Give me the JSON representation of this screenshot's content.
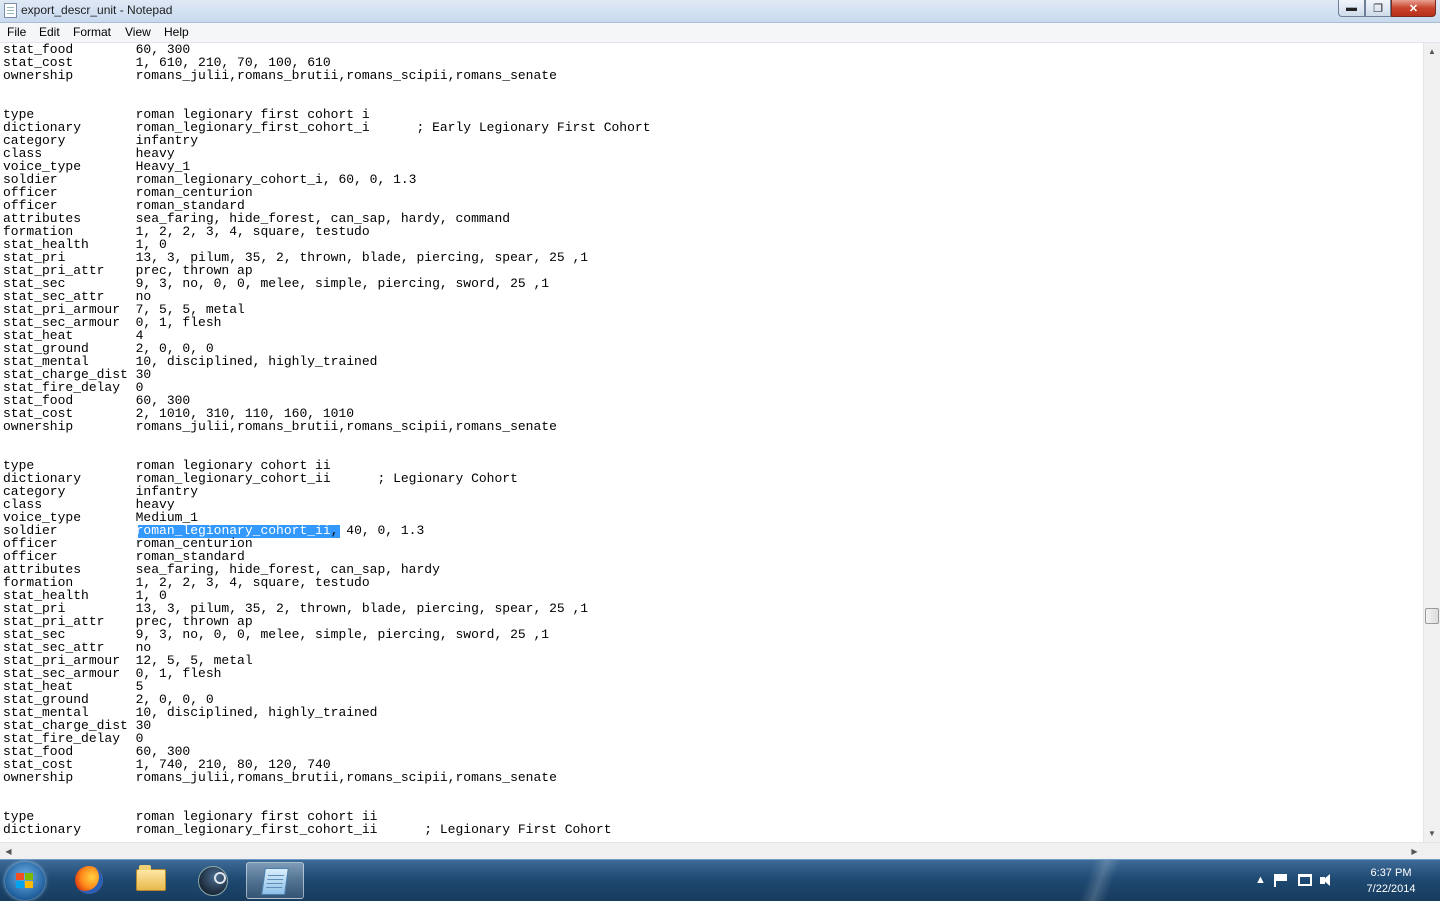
{
  "window": {
    "title": "export_descr_unit - Notepad",
    "minimize_glyph": "▬",
    "maximize_glyph": "❐",
    "close_glyph": "✕"
  },
  "menu": [
    "File",
    "Edit",
    "Format",
    "View",
    "Help"
  ],
  "editor": {
    "lines": [
      "stat_food        60, 300",
      "stat_cost        1, 610, 210, 70, 100, 610",
      "ownership        romans_julii,romans_brutii,romans_scipii,romans_senate",
      "",
      "",
      "type             roman legionary first cohort i",
      "dictionary       roman_legionary_first_cohort_i      ; Early Legionary First Cohort",
      "category         infantry",
      "class            heavy",
      "voice_type       Heavy_1",
      "soldier          roman_legionary_cohort_i, 60, 0, 1.3",
      "officer          roman_centurion",
      "officer          roman_standard",
      "attributes       sea_faring, hide_forest, can_sap, hardy, command",
      "formation        1, 2, 2, 3, 4, square, testudo",
      "stat_health      1, 0",
      "stat_pri         13, 3, pilum, 35, 2, thrown, blade, piercing, spear, 25 ,1",
      "stat_pri_attr    prec, thrown ap",
      "stat_sec         9, 3, no, 0, 0, melee, simple, piercing, sword, 25 ,1",
      "stat_sec_attr    no",
      "stat_pri_armour  7, 5, 5, metal",
      "stat_sec_armour  0, 1, flesh",
      "stat_heat        4",
      "stat_ground      2, 0, 0, 0",
      "stat_mental      10, disciplined, highly_trained",
      "stat_charge_dist 30",
      "stat_fire_delay  0",
      "stat_food        60, 300",
      "stat_cost        2, 1010, 310, 110, 160, 1010",
      "ownership        romans_julii,romans_brutii,romans_scipii,romans_senate",
      "",
      "",
      "type             roman legionary cohort ii",
      "dictionary       roman_legionary_cohort_ii      ; Legionary Cohort",
      "category         infantry",
      "class            heavy",
      "voice_type       Medium_1",
      "soldier          roman_legionary_cohort_ii, 40, 0, 1.3",
      "officer          roman_centurion",
      "officer          roman_standard",
      "attributes       sea_faring, hide_forest, can_sap, hardy",
      "formation        1, 2, 2, 3, 4, square, testudo",
      "stat_health      1, 0",
      "stat_pri         13, 3, pilum, 35, 2, thrown, blade, piercing, spear, 25 ,1",
      "stat_pri_attr    prec, thrown ap",
      "stat_sec         9, 3, no, 0, 0, melee, simple, piercing, sword, 25 ,1",
      "stat_sec_attr    no",
      "stat_pri_armour  12, 5, 5, metal",
      "stat_sec_armour  0, 1, flesh",
      "stat_heat        5",
      "stat_ground      2, 0, 0, 0",
      "stat_mental      10, disciplined, highly_trained",
      "stat_charge_dist 30",
      "stat_fire_delay  0",
      "stat_food        60, 300",
      "stat_cost        1, 740, 210, 80, 120, 740",
      "ownership        romans_julii,romans_brutii,romans_scipii,romans_senate",
      "",
      "",
      "type             roman legionary first cohort ii",
      "dictionary       roman_legionary_first_cohort_ii      ; Legionary First Cohort"
    ],
    "selected_text": "roman_legionary_cohort_ii",
    "selected_line": 37
  },
  "taskbar": {
    "apps": [
      "Firefox",
      "Windows Explorer",
      "Steam",
      "Notepad"
    ],
    "tray_chevron": "▲",
    "time": "6:37 PM",
    "date": "7/22/2014"
  },
  "colors": {
    "selection": "#3399ff",
    "taskbar": "#1f4a73"
  }
}
